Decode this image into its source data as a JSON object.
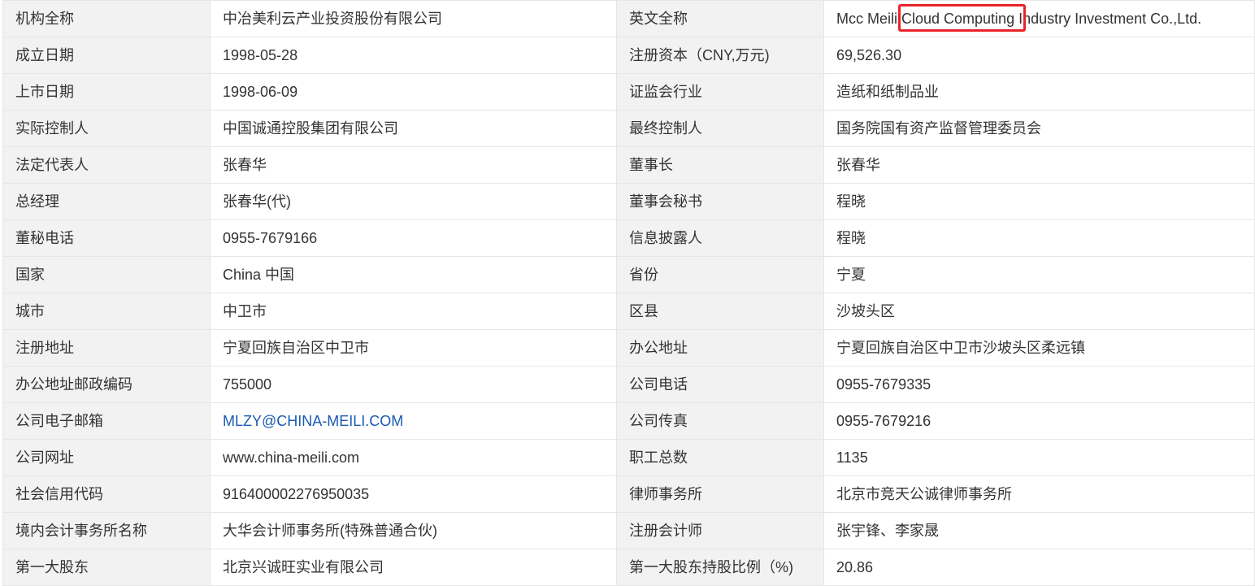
{
  "rows": [
    {
      "l1": "机构全称",
      "v1": "中冶美利云产业投资股份有限公司",
      "l2": "英文全称",
      "v2_pre": "Mcc Meili ",
      "v2_hl": "Cloud Computing",
      "v2_post": " Industry Investment Co.,Ltd."
    },
    {
      "l1": "成立日期",
      "v1": "1998-05-28",
      "l2": "注册资本（CNY,万元)",
      "v2": "69,526.30"
    },
    {
      "l1": "上市日期",
      "v1": "1998-06-09",
      "l2": "证监会行业",
      "v2": "造纸和纸制品业"
    },
    {
      "l1": "实际控制人",
      "v1": "中国诚通控股集团有限公司",
      "l2": "最终控制人",
      "v2": "国务院国有资产监督管理委员会"
    },
    {
      "l1": "法定代表人",
      "v1": "张春华",
      "l2": "董事长",
      "v2": "张春华"
    },
    {
      "l1": "总经理",
      "v1": "张春华(代)",
      "l2": "董事会秘书",
      "v2": "程晓"
    },
    {
      "l1": "董秘电话",
      "v1": "0955-7679166",
      "l2": "信息披露人",
      "v2": "程晓"
    },
    {
      "l1": "国家",
      "v1": "China 中国",
      "l2": "省份",
      "v2": "宁夏"
    },
    {
      "l1": "城市",
      "v1": "中卫市",
      "l2": "区县",
      "v2": "沙坡头区"
    },
    {
      "l1": "注册地址",
      "v1": "宁夏回族自治区中卫市",
      "l2": "办公地址",
      "v2": "宁夏回族自治区中卫市沙坡头区柔远镇"
    },
    {
      "l1": "办公地址邮政编码",
      "v1": "755000",
      "l2": "公司电话",
      "v2": "0955-7679335"
    },
    {
      "l1": "公司电子邮箱",
      "v1": "MLZY@CHINA-MEILI.COM",
      "l2": "公司传真",
      "v2": "0955-7679216"
    },
    {
      "l1": "公司网址",
      "v1": "www.china-meili.com",
      "l2": "职工总数",
      "v2": "1135"
    },
    {
      "l1": "社会信用代码",
      "v1": "916400002276950035",
      "l2": "律师事务所",
      "v2": "北京市竞天公诚律师事务所"
    },
    {
      "l1": "境内会计事务所名称",
      "v1": "大华会计师事务所(特殊普通合伙)",
      "l2": "注册会计师",
      "v2": "张宇锋、李家晟"
    },
    {
      "l1": "第一大股东",
      "v1": "北京兴诚旺实业有限公司",
      "l2": "第一大股东持股比例（%)",
      "v2": "20.86"
    }
  ],
  "colors": {
    "label_bg": "#f2f2f2",
    "border": "#e6e6e6",
    "link": "#1a5ab3",
    "highlight": "#e8242a"
  }
}
